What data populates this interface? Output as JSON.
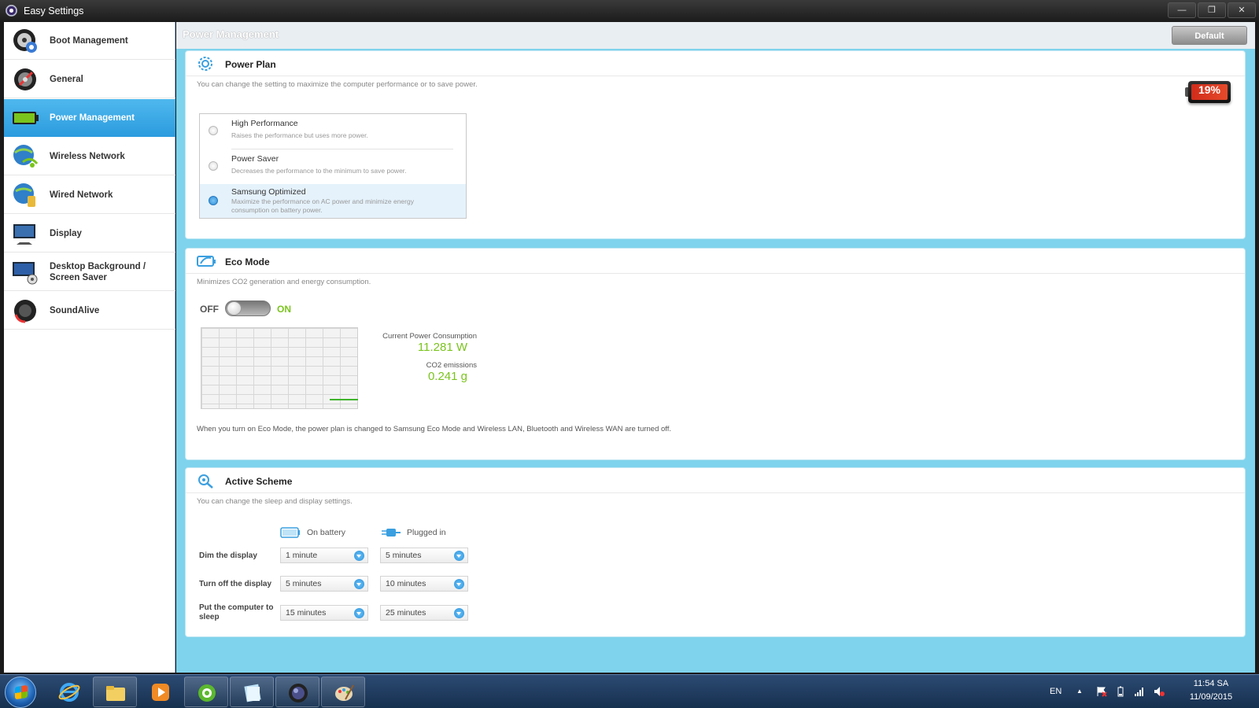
{
  "window": {
    "title": "Easy Settings",
    "minimize": "—",
    "maximize": "❐",
    "close": "✕"
  },
  "sidebar": {
    "items": [
      {
        "label": "Boot Management",
        "icon": "boot-icon"
      },
      {
        "label": "General",
        "icon": "general-icon"
      },
      {
        "label": "Power Management",
        "icon": "battery-icon",
        "active": true
      },
      {
        "label": "Wireless Network",
        "icon": "wireless-icon"
      },
      {
        "label": "Wired Network",
        "icon": "wired-icon"
      },
      {
        "label": "Display",
        "icon": "display-icon"
      },
      {
        "label": "Desktop Background / Screen Saver",
        "icon": "desktop-icon"
      },
      {
        "label": "SoundAlive",
        "icon": "sound-icon"
      }
    ]
  },
  "main": {
    "title": "Power Management",
    "default_label": "Default"
  },
  "power_plan": {
    "title": "Power Plan",
    "description": "You can change the setting to maximize the computer performance or to save power.",
    "battery_percent": "19%",
    "battery_level": 0.19,
    "options": [
      {
        "name": "High Performance",
        "desc": "Raises the performance but uses more power.",
        "selected": false
      },
      {
        "name": "Power Saver",
        "desc": "Decreases the performance to the minimum to save power.",
        "selected": false
      },
      {
        "name": "Samsung Optimized",
        "desc": "Maximize the performance on AC power and minimize energy consumption on battery power.",
        "selected": true
      }
    ]
  },
  "eco_mode": {
    "title": "Eco Mode",
    "description": "Minimizes CO2 generation and energy consumption.",
    "off_label": "OFF",
    "on_label": "ON",
    "enabled": false,
    "current_power_label": "Current Power Consumption",
    "current_power_value": "11.281 W",
    "co2_label": "CO2 emissions",
    "co2_value": "0.241 g",
    "note": "When you turn on Eco Mode, the power plan is changed to Samsung Eco Mode and Wireless LAN, Bluetooth and Wireless WAN are turned off."
  },
  "active_scheme": {
    "title": "Active Scheme",
    "description": "You can change the sleep and display settings.",
    "on_battery_label": "On battery",
    "plugged_in_label": "Plugged in",
    "rows": [
      {
        "label": "Dim the display",
        "battery": "1 minute",
        "plugged": "5 minutes"
      },
      {
        "label": "Turn off the display",
        "battery": "5 minutes",
        "plugged": "10 minutes"
      },
      {
        "label": "Put the computer to sleep",
        "battery": "15 minutes",
        "plugged": "25 minutes"
      }
    ]
  },
  "taskbar": {
    "language": "EN",
    "time": "11:54 SA",
    "date": "11/09/2015",
    "tray_arrow": "▲"
  }
}
